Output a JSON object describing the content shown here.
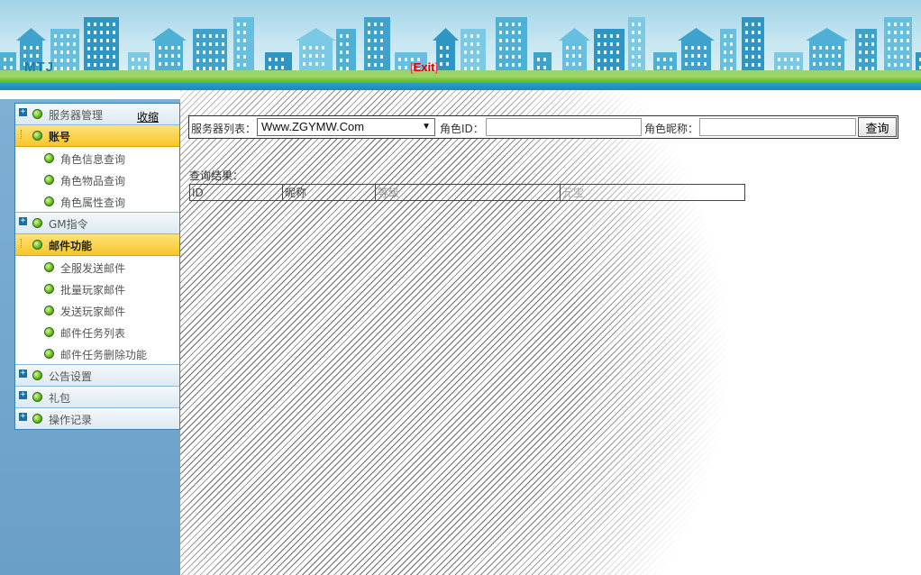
{
  "header": {
    "app_title": "MTJ",
    "exit_left_bracket": "[",
    "exit_label": "Exit",
    "exit_right_bracket": "]",
    "sky_color": "#9fd3e6",
    "accent_green": "#58b52b",
    "accent_blue": "#1d86bb"
  },
  "sidebar": {
    "collapse_label": "收缩",
    "groups": [
      {
        "label": "服务器管理",
        "icon": "plus-box-icon",
        "expanded": false,
        "items": []
      },
      {
        "label": "账号",
        "icon": "tree-line-icon",
        "expanded": true,
        "items": [
          {
            "label": "角色信息查询"
          },
          {
            "label": "角色物品查询"
          },
          {
            "label": "角色属性查询"
          }
        ]
      },
      {
        "label": "GM指令",
        "icon": "plus-box-icon",
        "expanded": false,
        "items": []
      },
      {
        "label": "邮件功能",
        "icon": "tree-line-icon",
        "expanded": true,
        "items": [
          {
            "label": "全服发送邮件"
          },
          {
            "label": "批量玩家邮件"
          },
          {
            "label": "发送玩家邮件"
          },
          {
            "label": "邮件任务列表"
          },
          {
            "label": "邮件任务删除功能"
          }
        ]
      },
      {
        "label": "公告设置",
        "icon": "plus-box-icon",
        "expanded": false,
        "items": []
      },
      {
        "label": "礼包",
        "icon": "plus-box-icon",
        "expanded": false,
        "items": []
      },
      {
        "label": "操作记录",
        "icon": "plus-box-icon",
        "expanded": false,
        "items": []
      }
    ],
    "active_color": "#f7c62a"
  },
  "search": {
    "server_label": "服务器列表：",
    "server_selected": "Www.ZGYMW.Com",
    "role_id_label": "角色ID：",
    "role_id_value": "",
    "nickname_label": "角色昵称：",
    "nickname_value": "",
    "query_button": "查询"
  },
  "results": {
    "label": "查询结果：",
    "columns": [
      "ID",
      "昵称",
      "等级",
      "元宝"
    ]
  }
}
